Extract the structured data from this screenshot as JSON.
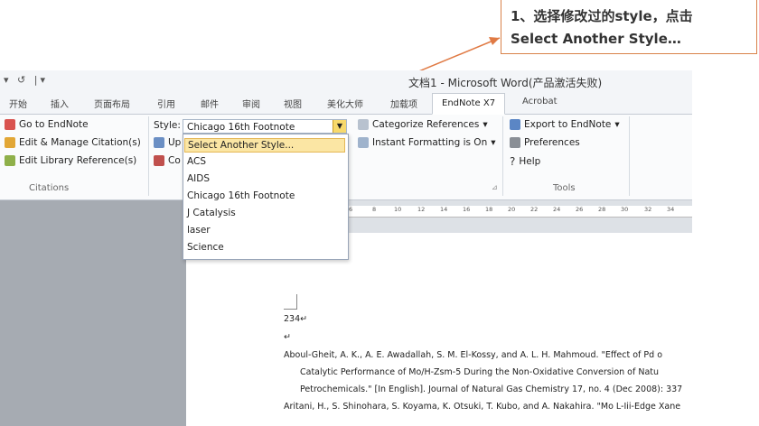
{
  "callout": {
    "line1": "1、选择修改过的style，点击",
    "line2": "Select Another Style…"
  },
  "titlebar": {
    "qat": "▾ ↺ |▾",
    "title": "文档1 - Microsoft Word(产品激活失败)"
  },
  "tabs": [
    "开始",
    "插入",
    "页面布局",
    "引用",
    "邮件",
    "审阅",
    "视图",
    "美化大师",
    "加载项",
    "EndNote X7",
    "Acrobat"
  ],
  "ribbon": {
    "citations": {
      "go_to": "Go to EndNote",
      "edit_manage": "Edit & Manage Citation(s)",
      "edit_library": "Edit Library Reference(s)",
      "label": "Citations"
    },
    "bibliography": {
      "style_label": "Style:",
      "style_value": "Chicago 16th Footnote",
      "update_partial": "Up",
      "convert_partial": "Co",
      "categorize": "Categorize References",
      "instant": "Instant Formatting is On"
    },
    "tools": {
      "export": "Export to EndNote",
      "preferences": "Preferences",
      "help": "Help",
      "label": "Tools"
    }
  },
  "style_menu": {
    "items": [
      "Select Another Style...",
      "ACS",
      "AIDS",
      "Chicago 16th Footnote",
      "J Catalysis",
      "laser",
      "Science"
    ]
  },
  "ruler_ticks": [
    "6",
    "8",
    "10",
    "12",
    "14",
    "16",
    "18",
    "20",
    "22",
    "24",
    "26",
    "28",
    "30",
    "32",
    "34"
  ],
  "document": {
    "lines": [
      "234↵",
      "↵",
      "Aboul-Gheit, A. K., A. E. Awadallah, S. M. El-Kossy, and A. L. H. Mahmoud. \"Effect of Pd o",
      "Catalytic Performance of Mo/H-Zsm-5 During the Non-Oxidative Conversion of Natu",
      "Petrochemicals.\" [In English]. Journal of Natural Gas Chemistry 17, no. 4 (Dec 2008): 337",
      "Aritani, H., S. Shinohara, S. Koyama, K. Otsuki, T. Kubo, and A. Nakahira. \"Mo L-Iii-Edge Xane"
    ]
  },
  "colors": {
    "accent_arrow": "#e07a44",
    "menu_highlight": "#fbe6a4",
    "left_pane": "#a6abb2"
  }
}
